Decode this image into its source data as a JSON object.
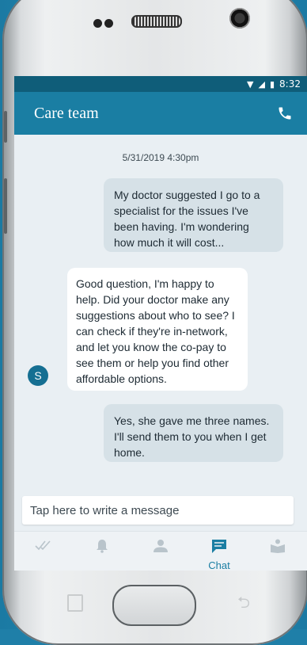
{
  "status_bar": {
    "time": "8:32"
  },
  "header": {
    "title": "Care team",
    "call_icon": "phone-icon"
  },
  "chat": {
    "timestamp": "5/31/2019 4:30pm",
    "messages": [
      {
        "sender": "user",
        "text": "My doctor suggested I go to a specialist for the issues I've been having. I'm wondering how much it will cost..."
      },
      {
        "sender": "care-team",
        "avatar": "S",
        "text": "Good question, I'm happy to help. Did your doctor make any suggestions about who to see? I can check if they're in-network, and let you know the co-pay to see them or help you find other affordable options."
      },
      {
        "sender": "user",
        "text": "Yes, she gave me three names. I'll send them to you when I get home."
      }
    ]
  },
  "composer": {
    "placeholder": "Tap here to write a message"
  },
  "tabs": [
    {
      "icon": "check-marks-icon",
      "label": ""
    },
    {
      "icon": "bell-icon",
      "label": ""
    },
    {
      "icon": "person-icon",
      "label": ""
    },
    {
      "icon": "chat-icon",
      "label": "Chat",
      "active": true
    },
    {
      "icon": "reading-person-icon",
      "label": ""
    }
  ],
  "colors": {
    "primary": "#1a7ea3",
    "status_bar": "#0f5d79",
    "chat_background": "#e9eff3",
    "outgoing_bubble": "#d6e1e7",
    "incoming_bubble": "#ffffff",
    "inactive_icon": "#b9c4cb"
  }
}
